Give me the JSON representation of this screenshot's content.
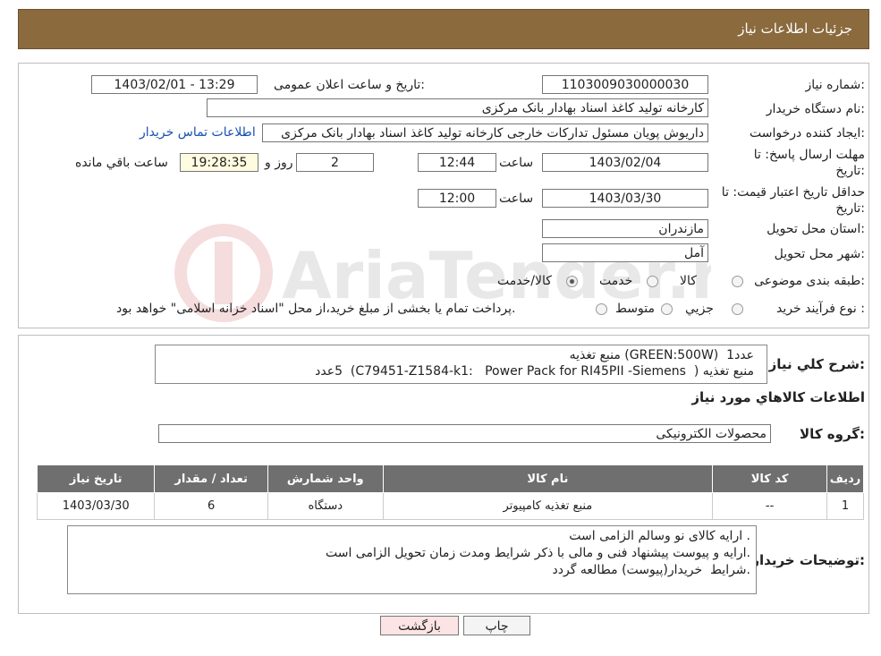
{
  "header": {
    "title": "جزئیات اطلاعات نیاز"
  },
  "fields": {
    "need_number_label": "شماره نیاز:",
    "need_number": "1103009030000030",
    "announce_label": "تاریخ و ساعت اعلان عمومی:",
    "announce_value": "1403/02/01 - 13:29",
    "buyer_org_label": "نام دستگاه خریدار:",
    "buyer_org": "کارخانه تولید کاغذ اسناد بهادار بانک مرکزی",
    "creator_label": "ایجاد کننده درخواست:",
    "creator": "داریوش  پویان مسئول تدارکات خارجی کارخانه تولید کاغذ اسناد بهادار بانک مرکزی",
    "contact_link": "اطلاعات تماس خریدار",
    "deadline_label1": "مهلت ارسال پاسخ: تا",
    "deadline_label2": "تاریخ:",
    "deadline_date": "1403/02/04",
    "time_label": "ساعت",
    "deadline_time": "12:44",
    "days": "2",
    "days_label": "روز و",
    "remaining": "19:28:35",
    "remaining_label": "ساعت باقي مانده",
    "validity_label1": "حداقل تاریخ اعتبار قیمت: تا",
    "validity_label2": "تاریخ:",
    "validity_date": "1403/03/30",
    "validity_time": "12:00",
    "province_label": "استان محل تحویل:",
    "province": "مازندران",
    "city_label": "شهر محل تحویل:",
    "city": "آمل",
    "category_label": "طبقه بندی موضوعی:",
    "category_options": [
      "کالا",
      "خدمت",
      "کالا/خدمت"
    ],
    "process_label": "نوع فرآیند خرید :",
    "process_options": [
      "جزیي",
      "متوسط"
    ],
    "process_note": "پرداخت تمام یا بخشی از مبلغ خرید،از محل \"اسناد خزانه اسلامی\" خواهد بود."
  },
  "description": {
    "label": "شرح کلي نياز:",
    "line1": "منبع تغذیه (GREEN:500W)  1عدد",
    "line2": "منبع تغذیه (  C79451-Z1584-k1:   Power Pack for RI45PII -Siemens)  5عدد"
  },
  "goods": {
    "section_title": "اطلاعات کالاهاي مورد نياز",
    "group_label": "گروه کالا:",
    "group_value": "محصولات الکترونیکی",
    "columns": [
      "رديف",
      "کد کالا",
      "نام کالا",
      "واحد شمارش",
      "تعداد / مقدار",
      "تاريخ نياز"
    ],
    "rows": [
      {
        "row": "1",
        "code": "--",
        "name": "منبع تغذیه کامپیوتر",
        "unit": "دستگاه",
        "qty": "6",
        "date": "1403/03/30"
      }
    ]
  },
  "buyer_notes": {
    "label": "توضیحات خریدار:",
    "text": "ارایه کالای نو وسالم الزامی است .\nارایه و پیوست پیشنهاد فنی و مالی با ذکر شرایط ومدت زمان تحویل الزامی است.\nشرایط  خریدار(پیوست) مطالعه گردد."
  },
  "buttons": {
    "print": "چاپ",
    "back": "بازگشت"
  },
  "watermark": "AriaTender.neT",
  "colors": {
    "header": "#8b6a3e",
    "table_header": "#6f6f6f",
    "back_button": "#fde4e4",
    "link": "#1a4fb0"
  }
}
